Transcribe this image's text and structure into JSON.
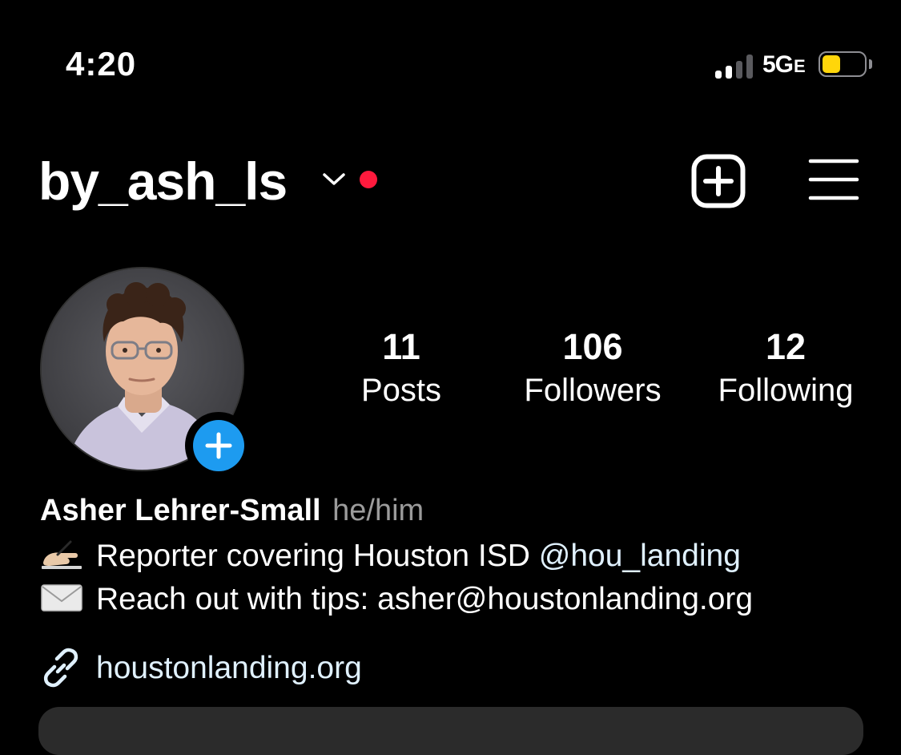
{
  "status_bar": {
    "time": "4:20",
    "network": "5G",
    "network_suffix": "E",
    "battery_color": "#ffd60a"
  },
  "header": {
    "username": "by_ash_ls",
    "dropdown_icon": "chevron-down-icon",
    "notification_dot_color": "#ff1a3d",
    "create_icon": "plus-square-icon",
    "menu_icon": "hamburger-menu-icon"
  },
  "stats": {
    "posts": {
      "value": "11",
      "label": "Posts"
    },
    "followers": {
      "value": "106",
      "label": "Followers"
    },
    "following": {
      "value": "12",
      "label": "Following"
    }
  },
  "bio": {
    "name": "Asher Lehrer-Small",
    "pronouns": "he/him",
    "line1_emoji": "writing-hand-icon",
    "line1_text": "Reporter covering Houston ISD ",
    "line1_mention": "@hou_landing",
    "line2_emoji": "envelope-icon",
    "line2_text": "Reach out with tips: asher@houstonlanding.org",
    "link_icon": "link-icon",
    "link": "houstonlanding.org"
  },
  "colors": {
    "background": "#000000",
    "accent_blue": "#1d9bf0",
    "link_text": "#e0f1ff"
  }
}
